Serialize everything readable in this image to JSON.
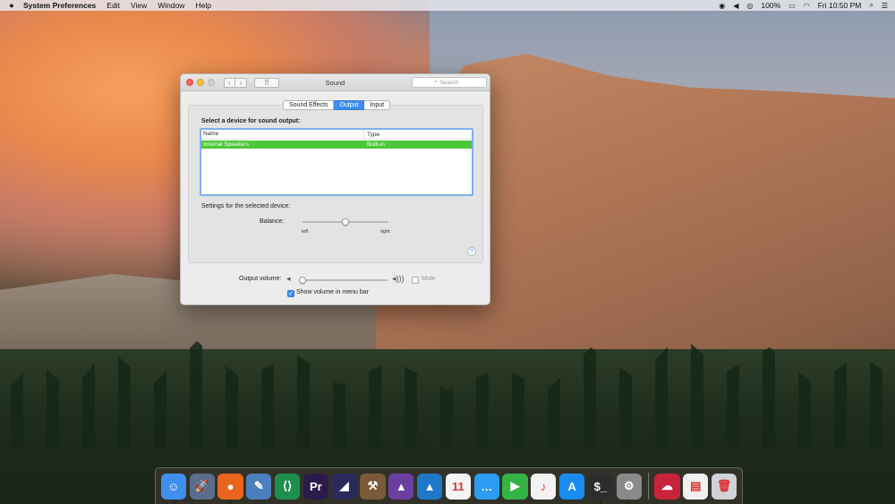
{
  "menubar": {
    "apple_icon": "apple-icon",
    "app_name": "System Preferences",
    "menus": [
      "Edit",
      "View",
      "Window",
      "Help"
    ],
    "battery": "100%",
    "clock": "Fri 10:50 PM"
  },
  "window": {
    "title": "Sound",
    "search_placeholder": "Search",
    "tabs": [
      "Sound Effects",
      "Output",
      "Input"
    ],
    "active_tab": "Output",
    "device_heading": "Select a device for sound output:",
    "table": {
      "columns": [
        "Name",
        "Type"
      ],
      "rows": [
        {
          "name": "Internal Speakers",
          "type": "Built-in",
          "selected": true
        }
      ]
    },
    "settings_heading": "Settings for the selected device:",
    "balance_label": "Balance:",
    "balance_value": 0.5,
    "balance_left": "left",
    "balance_right": "right",
    "help": "?",
    "output_volume_label": "Output volume:",
    "output_volume_value": 0.02,
    "mute_label": "Mute",
    "mute_checked": false,
    "show_volume_label": "Show volume in menu bar",
    "show_volume_checked": true
  },
  "dock": {
    "apps": [
      {
        "name": "finder",
        "glyph": "☺",
        "color": "#3d8ff0",
        "running": true
      },
      {
        "name": "launchpad",
        "glyph": "🚀",
        "color": "#5a6e8c",
        "running": false
      },
      {
        "name": "firefox",
        "glyph": "●",
        "color": "#e8651e",
        "running": true
      },
      {
        "name": "preview",
        "glyph": "✎",
        "color": "#4b7fbd",
        "running": false
      },
      {
        "name": "visual-studio-code",
        "glyph": "⟨⟩",
        "color": "#1f8f4e",
        "running": false
      },
      {
        "name": "premiere-pro",
        "glyph": "Pr",
        "color": "#2a1b4a",
        "running": false
      },
      {
        "name": "affinity",
        "glyph": "◢",
        "color": "#2b2a5c",
        "running": false
      },
      {
        "name": "instruments",
        "glyph": "⚒",
        "color": "#7a5a3a",
        "running": false
      },
      {
        "name": "affinity-photo",
        "glyph": "▲",
        "color": "#6b3fa0",
        "running": false
      },
      {
        "name": "affinity-designer",
        "glyph": "▲",
        "color": "#1e78c8",
        "running": false
      },
      {
        "name": "calendar",
        "glyph": "11",
        "color": "#f4f4f4",
        "running": false
      },
      {
        "name": "messages",
        "glyph": "…",
        "color": "#2b9cf2",
        "running": false
      },
      {
        "name": "facetime",
        "glyph": "▶",
        "color": "#33b444",
        "running": false
      },
      {
        "name": "music",
        "glyph": "♪",
        "color": "#f2f2f2",
        "running": false
      },
      {
        "name": "app-store",
        "glyph": "A",
        "color": "#1a8cf0",
        "running": false
      },
      {
        "name": "terminal",
        "glyph": "$_",
        "color": "#2d2d2d",
        "running": true
      },
      {
        "name": "system-preferences",
        "glyph": "⚙",
        "color": "#8a8a8a",
        "running": true
      }
    ],
    "stacks": [
      {
        "name": "creative-cloud-folder",
        "glyph": "☁",
        "color": "#c8233a"
      },
      {
        "name": "documents-stack",
        "glyph": "▤",
        "color": "#f0f0f0"
      },
      {
        "name": "trash",
        "glyph": "🗑",
        "color": "#cfd3d8"
      }
    ]
  }
}
